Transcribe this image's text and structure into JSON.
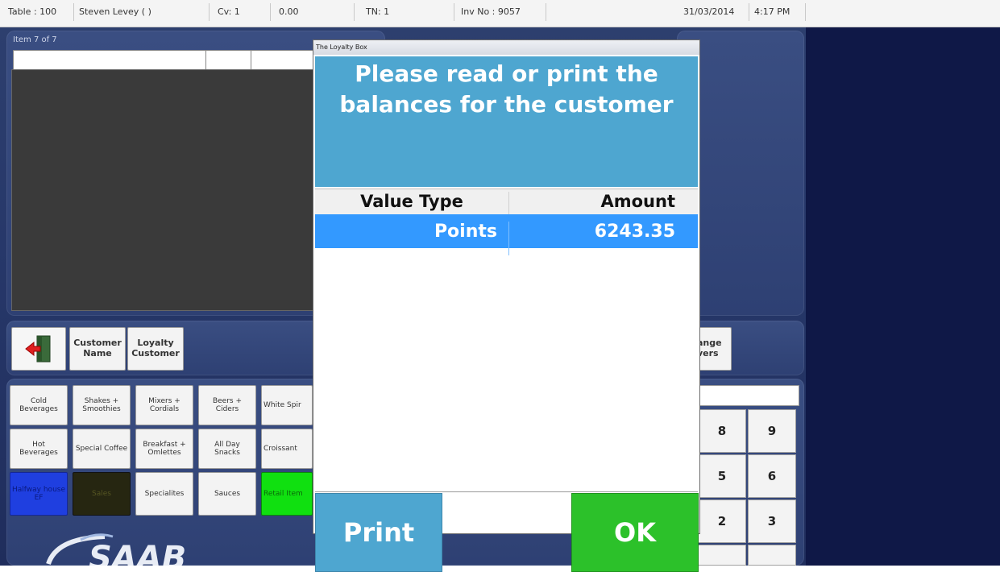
{
  "statusbar": {
    "table": "Table : 100",
    "user": "Steven Levey ( )",
    "covers": "Cv: 1",
    "amount": "0.00",
    "tn": "TN: 1",
    "invoice": "Inv No : 9057",
    "date": "31/03/2014",
    "time": "4:17 PM"
  },
  "order": {
    "item_counter": "Item 7 of 7"
  },
  "actions": {
    "customer_name": "Customer Name",
    "loyalty_customer": "Loyalty Customer",
    "change_covers": "ange vers"
  },
  "categories": {
    "row1": [
      "Cold Beverages",
      "Shakes + Smoothies",
      "Mixers + Cordials",
      "Beers + Ciders",
      "White Spir"
    ],
    "row2": [
      "Hot Beverages",
      "Special Coffee",
      "Breakfast + Omlettes",
      "All Day Snacks",
      "Croissant"
    ],
    "row3": [
      "Halfway house EF",
      "Sales",
      "Specialites",
      "Sauces",
      "Retail Item"
    ]
  },
  "numpad": {
    "k8": "8",
    "k9": "9",
    "k5": "5",
    "k6": "6",
    "k2": "2",
    "k3": "3"
  },
  "dialog": {
    "title": "The Loyalty Box",
    "message": "Please read or print the balances for the customer",
    "columns": [
      "Value Type",
      "Amount"
    ],
    "rows": [
      {
        "type": "Points",
        "amount": "6243.35"
      }
    ],
    "print_label": "Print",
    "ok_label": "OK"
  },
  "colors": {
    "accent_blue": "#4ea6d0",
    "selected_row": "#3399ff",
    "ok_green": "#2cc12a",
    "background": "#27386a"
  }
}
